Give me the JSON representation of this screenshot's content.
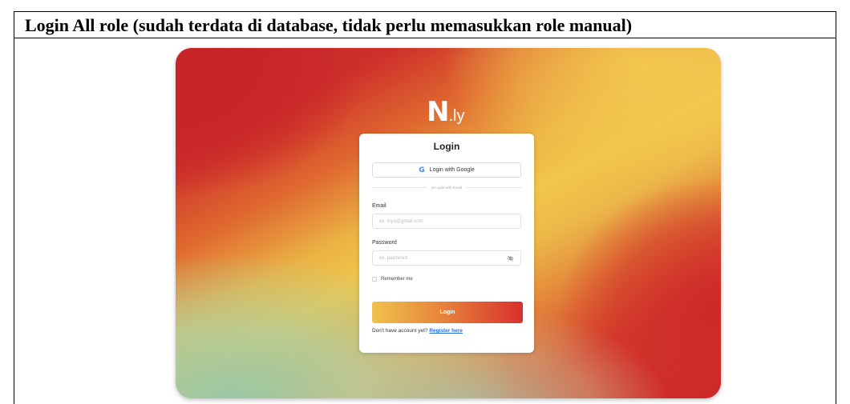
{
  "document": {
    "heading": "Login All role (sudah terdata di database, tidak perlu memasukkan role manual)"
  },
  "brand": {
    "name_main": "N",
    "name_suffix": ".ly"
  },
  "login_card": {
    "title": "Login",
    "google_button_label": "Login with Google",
    "google_icon_glyph": "G",
    "divider_text": "or Login with Email",
    "email": {
      "label": "Email",
      "placeholder": "ex. triya@gmail.com",
      "value": ""
    },
    "password": {
      "label": "Password",
      "placeholder": "ex. password",
      "value": "",
      "toggle_icon": "eye-slash-icon"
    },
    "remember_label": "Remember me",
    "remember_checked": false,
    "submit_label": "Login",
    "register_prompt": "Don't have account yet?",
    "register_link": "Register here"
  },
  "colors": {
    "gradient_red": "#c9262b",
    "gradient_yellow": "#f1c64a",
    "gradient_green": "#96c8aa",
    "link_blue": "#2a6fd6",
    "button_start": "#f0c24c",
    "button_end": "#d9302d"
  }
}
